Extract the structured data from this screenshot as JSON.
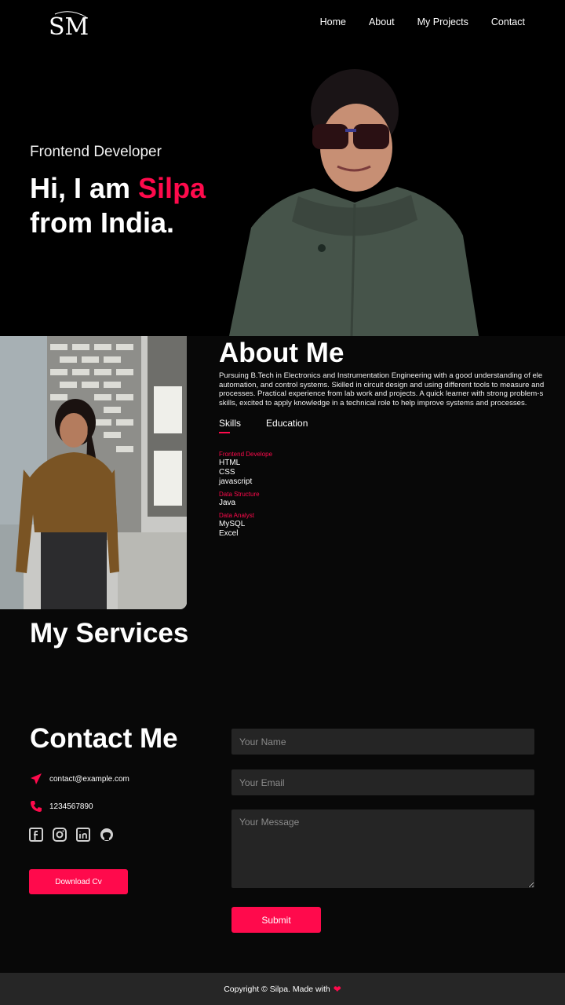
{
  "nav": {
    "logo_text": "SM",
    "items": [
      "Home",
      "About",
      "My Projects",
      "Contact"
    ]
  },
  "hero": {
    "subtitle": "Frontend Developer",
    "greeting": "Hi, I am ",
    "name": "Silpa",
    "location_line": "from India."
  },
  "about": {
    "title": "About Me",
    "lines": [
      "Pursuing B.Tech in Electronics and Instrumentation Engineering with a good understanding of ele",
      "automation, and control systems. Skilled in circuit design and using different tools to measure and",
      "processes. Practical experience from lab work and projects. A quick learner with strong problem-s",
      "skills, excited to apply knowledge in a technical role to help improve systems and processes."
    ],
    "tabs": [
      "Skills",
      "Education"
    ],
    "active_tab": "Skills",
    "skills": [
      {
        "heading": "Frontend Develope",
        "items": [
          "HTML",
          "CSS",
          "javascript"
        ]
      },
      {
        "heading": "Data Structure",
        "items": [
          "Java"
        ]
      },
      {
        "heading": "Data Analyst",
        "items": [
          "MySQL",
          "Excel"
        ]
      }
    ]
  },
  "services": {
    "title": "My Services"
  },
  "contact": {
    "title": "Contact Me",
    "email": "contact@example.com",
    "phone": "1234567890",
    "socials": [
      "facebook-icon",
      "instagram-icon",
      "linkedin-icon",
      "github-icon"
    ],
    "download_label": "Download Cv",
    "form": {
      "name_placeholder": "Your Name",
      "email_placeholder": "Your Email",
      "message_placeholder": "Your Message",
      "submit_label": "Submit"
    }
  },
  "footer": {
    "text": "Copyright © Silpa. Made with"
  },
  "colors": {
    "accent": "#ff0a4c",
    "background": "#080808",
    "field": "#252525",
    "footer": "#262626"
  }
}
